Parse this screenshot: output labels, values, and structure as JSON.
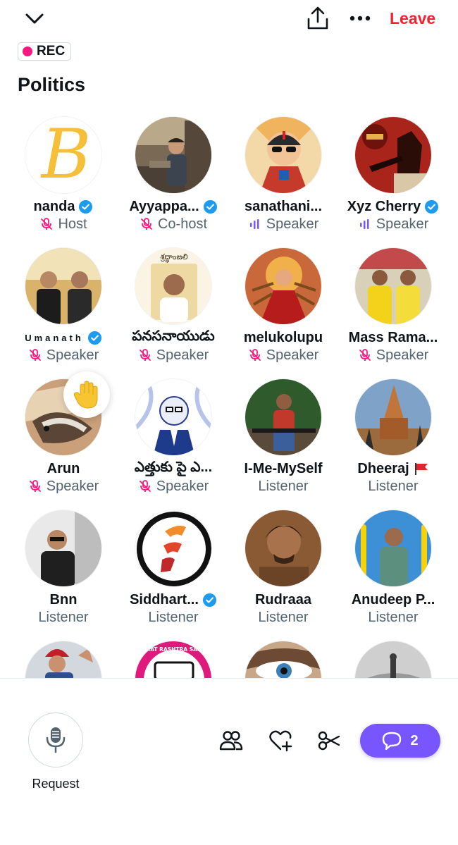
{
  "header": {
    "leave_label": "Leave",
    "rec_label": "REC",
    "title": "Politics",
    "icons": [
      "chevron-down-icon",
      "share-icon",
      "more-icon"
    ]
  },
  "colors": {
    "leave": "#f4212e",
    "rec_dot": "#f91880",
    "muted_mic": "#f91880",
    "speaking_bars": "#7856ff",
    "verified": "#1d9bf0",
    "chat_button": "#7856ff"
  },
  "participants": [
    {
      "name": "nanda",
      "role": "Host",
      "verified": true,
      "muted": true
    },
    {
      "name": "Ayyappa...",
      "role": "Co-host",
      "verified": true,
      "muted": true
    },
    {
      "name": "sanathani...",
      "role": "Speaker",
      "verified": false,
      "speaking": true
    },
    {
      "name": "Xyz Cherry",
      "role": "Speaker",
      "verified": true,
      "speaking": true
    },
    {
      "name": "Umanath",
      "role": "Speaker",
      "verified": true,
      "muted": true
    },
    {
      "name": "పనసనాయుడు",
      "role": "Speaker",
      "verified": false,
      "muted": true
    },
    {
      "name": "melukolupu",
      "role": "Speaker",
      "verified": false,
      "muted": true
    },
    {
      "name": "Mass Rama...",
      "role": "Speaker",
      "verified": false,
      "muted": true
    },
    {
      "name": "Arun",
      "role": "Speaker",
      "verified": false,
      "muted": true,
      "hand_raised": true
    },
    {
      "name": "ఎత్తుకు పై ఎ...",
      "role": "Speaker",
      "verified": false,
      "muted": true
    },
    {
      "name": "I-Me-MySelf",
      "role": "Listener",
      "verified": false
    },
    {
      "name": "Dheeraj",
      "role": "Listener",
      "verified": false,
      "flag": true
    },
    {
      "name": "Bnn",
      "role": "Listener",
      "verified": false
    },
    {
      "name": "Siddhart...",
      "role": "Listener",
      "verified": true
    },
    {
      "name": "Rudraaa",
      "role": "Listener",
      "verified": false
    },
    {
      "name": "Anudeep P...",
      "role": "Listener",
      "verified": false
    },
    {
      "name": "",
      "role": "",
      "verified": false
    },
    {
      "name": "",
      "role": "",
      "verified": false
    },
    {
      "name": "",
      "role": "",
      "verified": false
    },
    {
      "name": "",
      "role": "",
      "verified": false
    }
  ],
  "avatar_badge_text": "BHARAT RASHTRA SAMITHI",
  "avatar_logo_letter": "B",
  "avatar_banner_text": "శ్రద్ధాంజలి",
  "footer": {
    "request_label": "Request",
    "chat_count": "2",
    "tools": [
      "people-icon",
      "heart-plus-icon",
      "clip-icon"
    ]
  }
}
